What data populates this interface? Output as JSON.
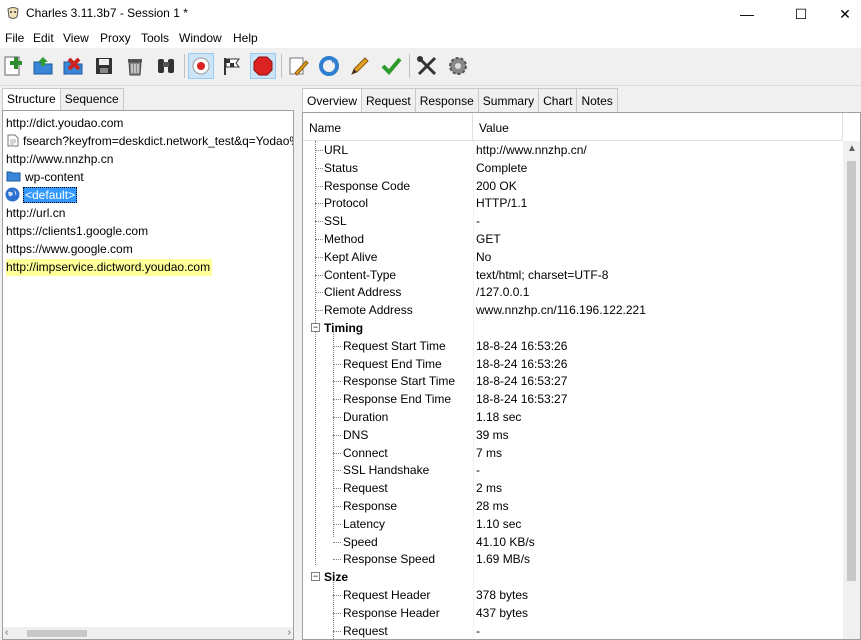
{
  "window": {
    "title": "Charles 3.11.3b7 - Session 1 *",
    "controls": {
      "minimize": "—",
      "maximize": "☐",
      "close": "✕"
    }
  },
  "menu": [
    "File",
    "Edit",
    "View",
    "Proxy",
    "Tools",
    "Window",
    "Help"
  ],
  "toolbar": {
    "buttons": [
      {
        "icon": "new-session-icon",
        "color": "#2e8b2e"
      },
      {
        "icon": "open-folder-icon",
        "color": "#2f7fd0"
      },
      {
        "icon": "close-session-icon",
        "color": "#cc2222"
      },
      {
        "icon": "save-icon",
        "color": "#333333"
      },
      {
        "icon": "trash-icon",
        "color": "#555555"
      },
      {
        "icon": "binoculars-icon",
        "color": "#333333"
      },
      {
        "icon": "record-icon",
        "color": "#dd2222",
        "active": true
      },
      {
        "icon": "throttle-icon",
        "color": "#333333"
      },
      {
        "icon": "breakpoints-icon",
        "color": "#dd2222",
        "active": true
      },
      {
        "icon": "compose-icon",
        "color": "#aa7722"
      },
      {
        "icon": "repeat-icon",
        "color": "#2f7fd0"
      },
      {
        "icon": "edit-pencil-icon",
        "color": "#e0a020"
      },
      {
        "icon": "validate-check-icon",
        "color": "#2e9b2e"
      },
      {
        "icon": "tools-icon",
        "color": "#333333"
      },
      {
        "icon": "settings-gear-icon",
        "color": "#777777"
      }
    ]
  },
  "left": {
    "tabs": [
      "Structure",
      "Sequence"
    ],
    "tree": [
      {
        "label": "http://dict.youdao.com",
        "indent": 0,
        "icon": ""
      },
      {
        "label": "fsearch?keyfrom=deskdict.network_test&q=Yodao%",
        "indent": 1,
        "icon": "file-icon"
      },
      {
        "label": "http://www.nnzhp.cn",
        "indent": 0,
        "icon": ""
      },
      {
        "label": "wp-content",
        "indent": 1,
        "icon": "folder-icon"
      },
      {
        "label": "<default>",
        "indent": 1,
        "icon": "globe-icon",
        "selected": true
      },
      {
        "label": "http://url.cn",
        "indent": 0,
        "icon": ""
      },
      {
        "label": "https://clients1.google.com",
        "indent": 0,
        "icon": ""
      },
      {
        "label": "https://www.google.com",
        "indent": 0,
        "icon": ""
      },
      {
        "label": "http://impservice.dictword.youdao.com",
        "indent": 0,
        "icon": "",
        "highlight": true
      }
    ]
  },
  "right": {
    "tabs": [
      "Overview",
      "Request",
      "Response",
      "Summary",
      "Chart",
      "Notes"
    ],
    "columns": [
      "Name",
      "Value"
    ],
    "rows": [
      {
        "name": "URL",
        "value": "http://www.nnzhp.cn/",
        "level": 1
      },
      {
        "name": "Status",
        "value": "Complete",
        "level": 1
      },
      {
        "name": "Response Code",
        "value": "200 OK",
        "level": 1
      },
      {
        "name": "Protocol",
        "value": "HTTP/1.1",
        "level": 1
      },
      {
        "name": "SSL",
        "value": "-",
        "level": 1
      },
      {
        "name": "Method",
        "value": "GET",
        "level": 1
      },
      {
        "name": "Kept Alive",
        "value": "No",
        "level": 1
      },
      {
        "name": "Content-Type",
        "value": "text/html; charset=UTF-8",
        "level": 1
      },
      {
        "name": "Client Address",
        "value": "/127.0.0.1",
        "level": 1
      },
      {
        "name": "Remote Address",
        "value": "www.nnzhp.cn/116.196.122.221",
        "level": 1
      },
      {
        "name": "Timing",
        "value": "",
        "level": 0,
        "section": true
      },
      {
        "name": "Request Start Time",
        "value": "18-8-24 16:53:26",
        "level": 2
      },
      {
        "name": "Request End Time",
        "value": "18-8-24 16:53:26",
        "level": 2
      },
      {
        "name": "Response Start Time",
        "value": "18-8-24 16:53:27",
        "level": 2
      },
      {
        "name": "Response End Time",
        "value": "18-8-24 16:53:27",
        "level": 2
      },
      {
        "name": "Duration",
        "value": "1.18 sec",
        "level": 2
      },
      {
        "name": "DNS",
        "value": "39 ms",
        "level": 2
      },
      {
        "name": "Connect",
        "value": "7 ms",
        "level": 2
      },
      {
        "name": "SSL Handshake",
        "value": "-",
        "level": 2
      },
      {
        "name": "Request",
        "value": "2 ms",
        "level": 2
      },
      {
        "name": "Response",
        "value": "28 ms",
        "level": 2
      },
      {
        "name": "Latency",
        "value": "1.10 sec",
        "level": 2
      },
      {
        "name": "Speed",
        "value": "41.10 KB/s",
        "level": 2
      },
      {
        "name": "Response Speed",
        "value": "1.69 MB/s",
        "level": 2
      },
      {
        "name": "Size",
        "value": "",
        "level": 0,
        "section": true
      },
      {
        "name": "Request Header",
        "value": "378 bytes",
        "level": 2
      },
      {
        "name": "Response Header",
        "value": "437 bytes",
        "level": 2
      },
      {
        "name": "Request",
        "value": "-",
        "level": 2
      }
    ]
  }
}
